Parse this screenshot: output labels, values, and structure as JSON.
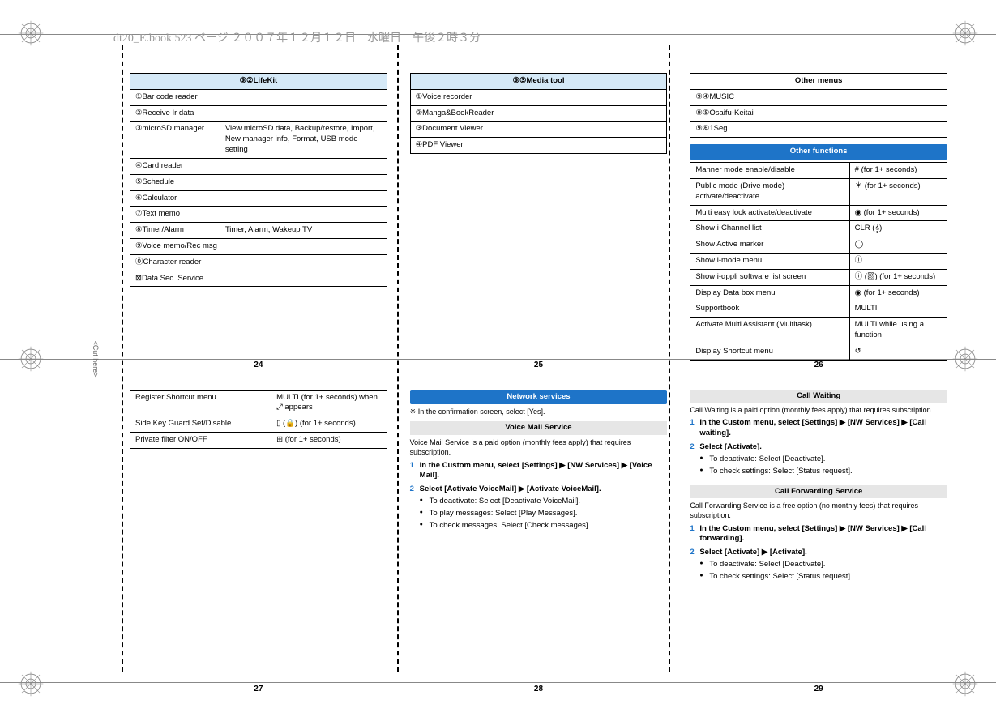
{
  "book_header": "dt20_E.book  523 ページ  ２００７年１２月１２日　水曜日　午後２時３分",
  "cut_label": "<Cut here>",
  "page_numbers": [
    "–24–",
    "–25–",
    "–26–",
    "–27–",
    "–28–",
    "–29–"
  ],
  "cell24": {
    "title": "⑨②LifeKit",
    "rows": [
      [
        "①Bar code reader",
        ""
      ],
      [
        "②Receive Ir data",
        ""
      ],
      [
        "③microSD manager",
        "View microSD data, Backup/restore, Import, New manager info, Format, USB mode setting"
      ],
      [
        "④Card reader",
        ""
      ],
      [
        "⑤Schedule",
        ""
      ],
      [
        "⑥Calculator",
        ""
      ],
      [
        "⑦Text memo",
        ""
      ],
      [
        "⑧Timer/Alarm",
        "Timer, Alarm, Wakeup TV"
      ],
      [
        "⑨Voice memo/Rec msg",
        ""
      ],
      [
        "⓪Character reader",
        ""
      ],
      [
        "⊠Data Sec. Service",
        ""
      ]
    ]
  },
  "cell25": {
    "title": "⑨③Media tool",
    "rows": [
      "①Voice recorder",
      "②Manga&BookReader",
      "③Document Viewer",
      "④PDF Viewer"
    ]
  },
  "cell26": {
    "title": "Other menus",
    "menu_rows": [
      "⑨④MUSIC",
      "⑨⑤Osaifu-Keitai",
      "⑨⑥1Seg"
    ],
    "section_title": "Other functions",
    "func_rows": [
      [
        "Manner mode enable/disable",
        "# (for 1+ seconds)"
      ],
      [
        "Public mode (Drive mode) activate/deactivate",
        "＊ (for 1+ seconds)"
      ],
      [
        "Multi easy lock activate/deactivate",
        "◉ (for 1+ seconds)"
      ],
      [
        "Show i-Channel list",
        "CLR (𝄞)"
      ],
      [
        "Show Active marker",
        "◯"
      ],
      [
        "Show i-mode menu",
        "ⓘ"
      ],
      [
        "Show i-αppli software list screen",
        "ⓘ (▨) (for 1+ seconds)"
      ],
      [
        "Display Data box menu",
        "◉ (for 1+ seconds)"
      ],
      [
        "Supportbook",
        "MULTI"
      ],
      [
        "Activate Multi Assistant (Multitask)",
        "MULTI while using a function"
      ],
      [
        "Display Shortcut menu",
        "↺"
      ]
    ]
  },
  "cell27": {
    "rows": [
      [
        "Register Shortcut menu",
        "MULTI (for 1+ seconds) when ⤢ appears"
      ],
      [
        "Side Key Guard Set/Disable",
        "▯ (🔒) (for 1+ seconds)"
      ],
      [
        "Private filter ON/OFF",
        "⊞ (for 1+ seconds)"
      ]
    ]
  },
  "cell28": {
    "section_title": "Network services",
    "note": "※ In the confirmation screen, select [Yes].",
    "sub1_title": "Voice Mail Service",
    "sub1_intro": "Voice Mail Service is a paid option (monthly fees apply) that requires subscription.",
    "steps1": [
      "In the Custom menu, select [Settings] ▶ [NW Services] ▶ [Voice Mail].",
      "Select [Activate VoiceMail] ▶ [Activate VoiceMail]."
    ],
    "bullets1": [
      "To deactivate: Select [Deactivate VoiceMail].",
      "To play messages: Select [Play Messages].",
      "To check messages: Select [Check messages]."
    ]
  },
  "cell29": {
    "sub1_title": "Call Waiting",
    "sub1_intro": "Call Waiting is a paid option (monthly fees apply) that requires subscription.",
    "steps1": [
      "In the Custom menu, select [Settings] ▶ [NW Services] ▶ [Call waiting].",
      "Select [Activate]."
    ],
    "bullets1": [
      "To deactivate: Select [Deactivate].",
      "To check settings: Select [Status request]."
    ],
    "sub2_title": "Call Forwarding Service",
    "sub2_intro": "Call Forwarding Service is a free option (no monthly fees) that requires subscription.",
    "steps2": [
      "In the Custom menu, select [Settings] ▶ [NW Services] ▶ [Call forwarding].",
      "Select [Activate] ▶ [Activate]."
    ],
    "bullets2": [
      "To deactivate: Select [Deactivate].",
      "To check settings: Select [Status request]."
    ]
  }
}
